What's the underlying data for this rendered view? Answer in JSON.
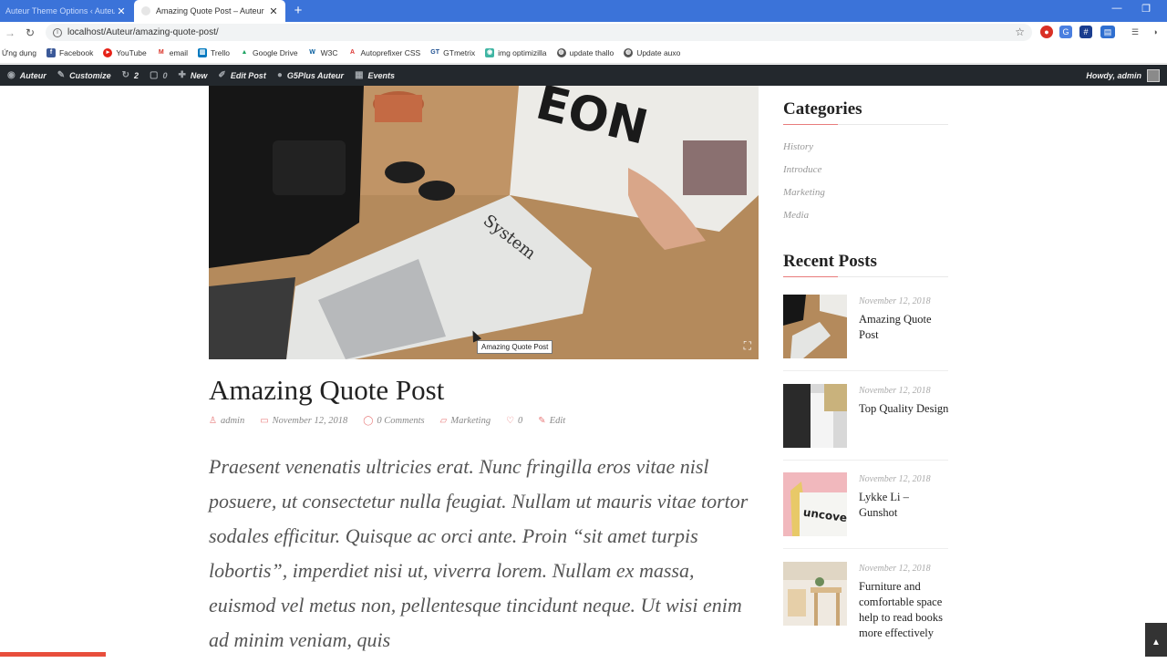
{
  "browser": {
    "tabs": [
      {
        "title": "Auteur Theme Options ‹ Auteur",
        "active": false
      },
      {
        "title": "Amazing Quote Post – Auteur",
        "active": true
      }
    ],
    "new_tab": "+",
    "url": "localhost/Auteur/amazing-quote-post/",
    "bookmarks": [
      {
        "label": "Ứng dụng",
        "icon": "apps-icon"
      },
      {
        "label": "Facebook",
        "icon": "facebook-icon"
      },
      {
        "label": "YouTube",
        "icon": "youtube-icon"
      },
      {
        "label": "email",
        "icon": "gmail-icon"
      },
      {
        "label": "Trello",
        "icon": "trello-icon"
      },
      {
        "label": "Google Drive",
        "icon": "drive-icon"
      },
      {
        "label": "W3C",
        "icon": "w3c-icon"
      },
      {
        "label": "Autoprefixer CSS",
        "icon": "autoprefixer-icon"
      },
      {
        "label": "GTmetrix",
        "icon": "gtmetrix-icon"
      },
      {
        "label": "img optimizilla",
        "icon": "optimizilla-icon"
      },
      {
        "label": "update thallo",
        "icon": "globe-icon"
      },
      {
        "label": "Update auxo",
        "icon": "globe-icon"
      }
    ]
  },
  "adminbar": {
    "site": "Auteur",
    "customize": "Customize",
    "updates": "2",
    "comments": "0",
    "new": "New",
    "edit_post": "Edit Post",
    "g5plus": "G5Plus Auteur",
    "events": "Events",
    "howdy": "Howdy, admin"
  },
  "post": {
    "image_tooltip": "Amazing Quote Post",
    "title": "Amazing Quote Post",
    "author": "admin",
    "date": "November 12, 2018",
    "comments": "0 Comments",
    "category": "Marketing",
    "likes": "0",
    "edit": "Edit",
    "excerpt": "Praesent venenatis ultricies erat. Nunc fringilla eros vitae nisl posuere, ut consectetur nulla feugiat. Nullam ut mauris vitae tortor sodales efficitur. Quisque ac orci ante. Proin “sit amet turpis lobortis”, imperdiet nisi ut, viverra lorem. Nullam ex massa, euismod vel metus non, pellentesque tincidunt neque. Ut wisi enim ad minim veniam, quis"
  },
  "sidebar": {
    "categories_title": "Categories",
    "categories": [
      "History",
      "Introduce",
      "Marketing",
      "Media"
    ],
    "recent_title": "Recent Posts",
    "recent": [
      {
        "date": "November 12, 2018",
        "title": "Amazing Quote Post"
      },
      {
        "date": "November 12, 2018",
        "title": "Top Quality Design"
      },
      {
        "date": "November 12, 2018",
        "title": "Lykke Li – Gunshot"
      },
      {
        "date": "November 12, 2018",
        "title": "Furniture and comfortable space help to read books more effectively"
      }
    ]
  },
  "colors": {
    "accent": "#e87c7c",
    "adminbar": "#23282d",
    "tabbar": "#3b73d9"
  }
}
